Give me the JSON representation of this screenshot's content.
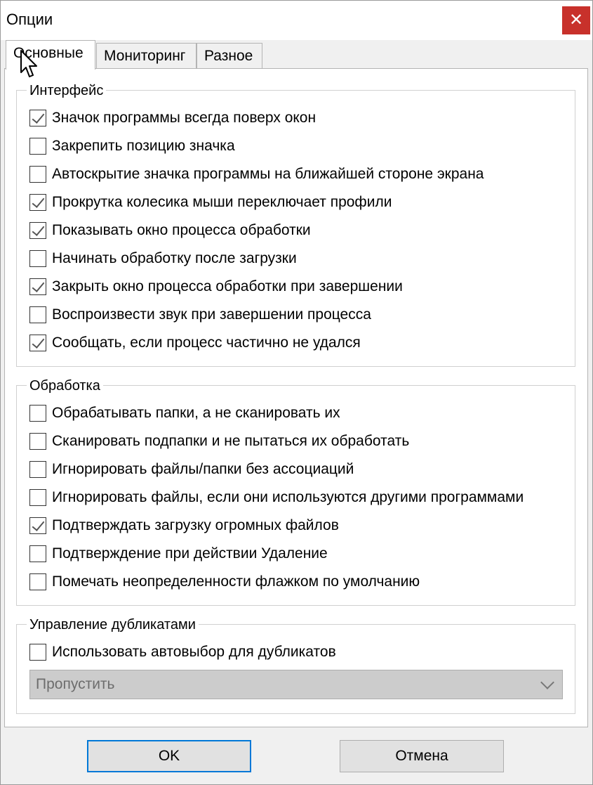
{
  "window": {
    "title": "Опции",
    "close_symbol": "✕",
    "accent": "#c8312b"
  },
  "tabs": [
    {
      "label": "Основные",
      "active": true
    },
    {
      "label": "Мониторинг",
      "active": false
    },
    {
      "label": "Разное",
      "active": false
    }
  ],
  "interface_group": {
    "legend": "Интерфейс",
    "options": [
      {
        "label": "Значок программы всегда поверх окон",
        "checked": true
      },
      {
        "label": "Закрепить позицию значка",
        "checked": false
      },
      {
        "label": "Автоскрытие значка программы на ближайшей стороне экрана",
        "checked": false
      },
      {
        "label": "Прокрутка колесика мыши переключает профили",
        "checked": true
      },
      {
        "label": "Показывать окно процесса обработки",
        "checked": true
      },
      {
        "label": "Начинать обработку после загрузки",
        "checked": false
      },
      {
        "label": "Закрыть окно процесса обработки при завершении",
        "checked": true
      },
      {
        "label": "Воспроизвести звук при завершении процесса",
        "checked": false
      },
      {
        "label": "Сообщать, если процесс частично не удался",
        "checked": true
      }
    ]
  },
  "processing_group": {
    "legend": "Обработка",
    "options": [
      {
        "label": "Обрабатывать папки, а не сканировать их",
        "checked": false
      },
      {
        "label": "Сканировать подпапки и не пытаться их обработать",
        "checked": false
      },
      {
        "label": "Игнорировать файлы/папки без ассоциаций",
        "checked": false
      },
      {
        "label": "Игнорировать файлы, если они используются другими программами",
        "checked": false
      },
      {
        "label": "Подтверждать загрузку огромных файлов",
        "checked": true
      },
      {
        "label": "Подтверждение при действии Удаление",
        "checked": false
      },
      {
        "label": "Помечать неопределенности флажком по умолчанию",
        "checked": false
      }
    ]
  },
  "duplicates_group": {
    "legend": "Управление дубликатами",
    "autoselect": {
      "label": "Использовать автовыбор для дубликатов",
      "checked": false
    },
    "dropdown": {
      "value": "Пропустить",
      "disabled": true
    }
  },
  "buttons": {
    "ok": "OK",
    "cancel": "Отмена"
  }
}
